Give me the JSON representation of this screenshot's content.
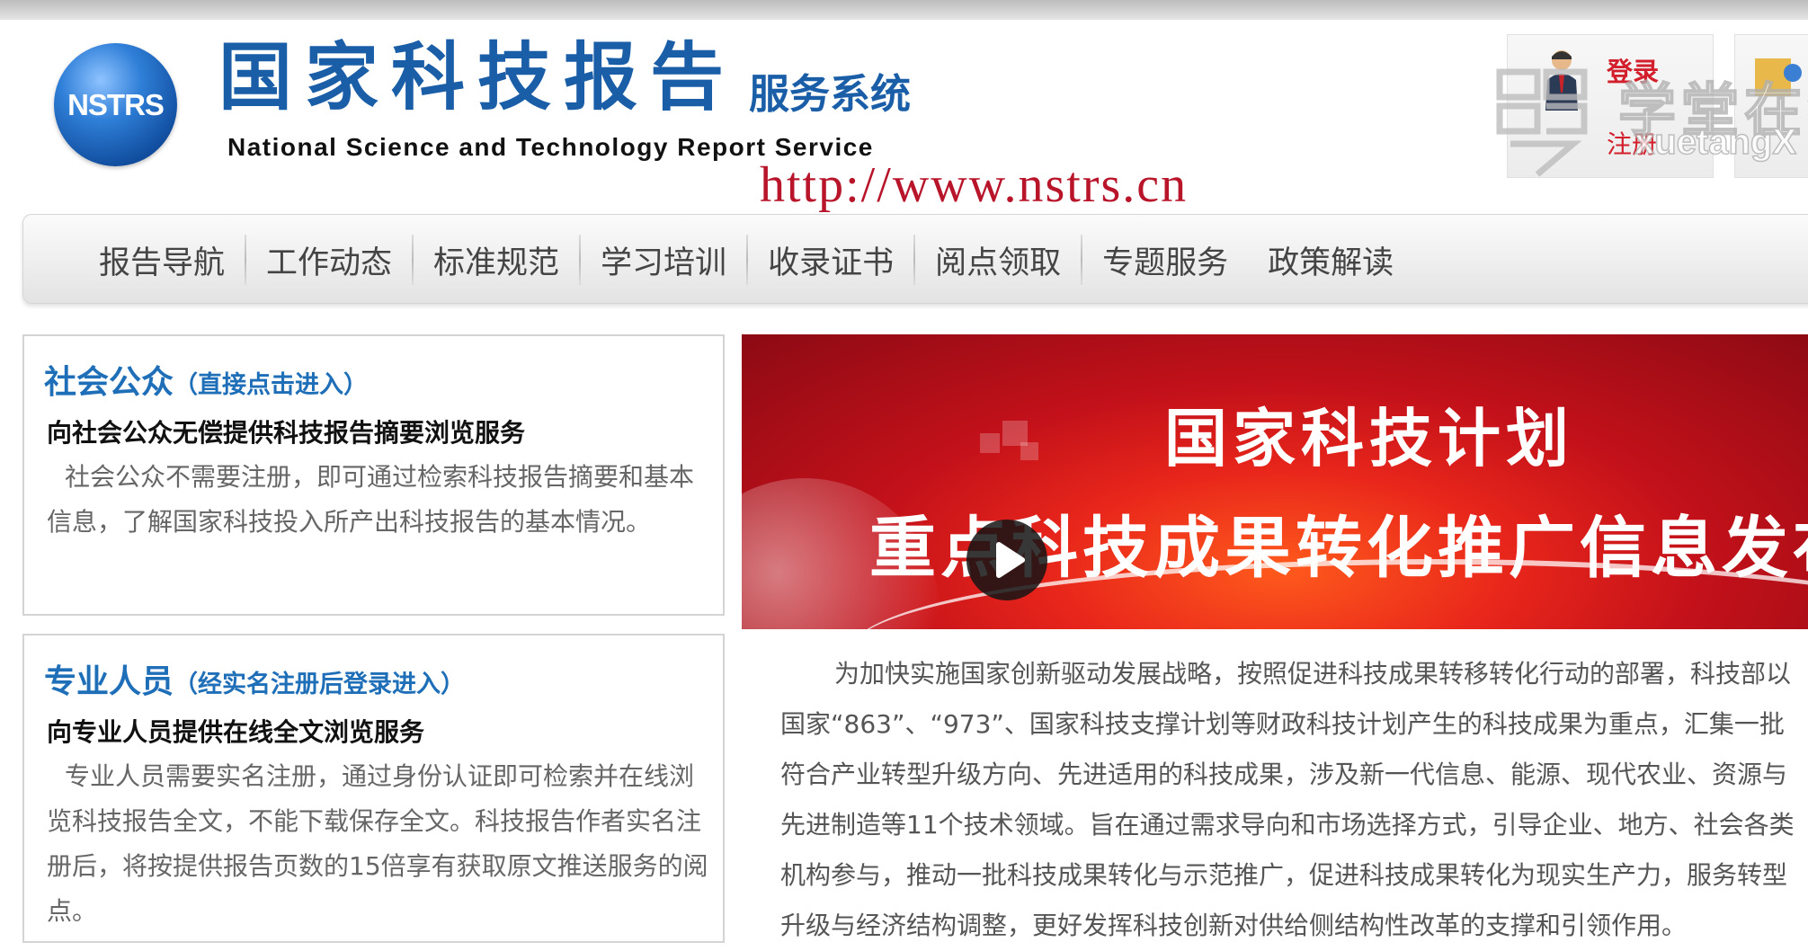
{
  "header": {
    "logo_text": "NSTRS",
    "title_cn": "国家科技报告",
    "title_sub": "服务系统",
    "title_en": "National Science and Technology Report Service",
    "url": "http://www.nstrs.cn",
    "login_label": "登录",
    "register_label": "注册",
    "watermark_cn": "学堂在线",
    "watermark_en": "xuetangX"
  },
  "nav": {
    "items": [
      "报告导航",
      "工作动态",
      "标准规范",
      "学习培训",
      "收录证书",
      "阅点领取",
      "专题服务",
      "政策解读"
    ]
  },
  "panels": [
    {
      "title": "社会公众",
      "link": "（直接点击进入）",
      "subtitle": "向社会公众无偿提供科技报告摘要浏览服务",
      "body": "社会公众不需要注册，即可通过检索科技报告摘要和基本信息，了解国家科技投入所产出科技报告的基本情况。"
    },
    {
      "title": "专业人员",
      "link": "（经实名注册后登录进入）",
      "subtitle": "向专业人员提供在线全文浏览服务",
      "body": "专业人员需要实名注册，通过身份认证即可检索并在线浏览科技报告全文，不能下载保存全文。科技报告作者实名注册后，将按提供报告页数的15倍享有获取原文推送服务的阅点。"
    }
  ],
  "banner": {
    "line1": "国家科技计划",
    "line2": "重点科技成果转化推广信息发布"
  },
  "article": {
    "text": "为加快实施国家创新驱动发展战略，按照促进科技成果转移转化行动的部署，科技部以国家“863”、“973”、国家科技支撑计划等财政科技计划产生的科技成果为重点，汇集一批符合产业转型升级方向、先进适用的科技成果，涉及新一代信息、能源、现代农业、资源与先进制造等11个技术领域。旨在通过需求导向和市场选择方式，引导企业、地方、社会各类机构参与，推动一批科技成果转化与示范推广，促进科技成果转化为现实生产力，服务转型升级与经济结构调整，更好发挥科技创新对供给侧结构性改革的支撑和引领作用。"
  },
  "colors": {
    "brand_blue": "#1b5ea8",
    "url_red": "#b8142a",
    "banner_red": "#c3111a"
  }
}
